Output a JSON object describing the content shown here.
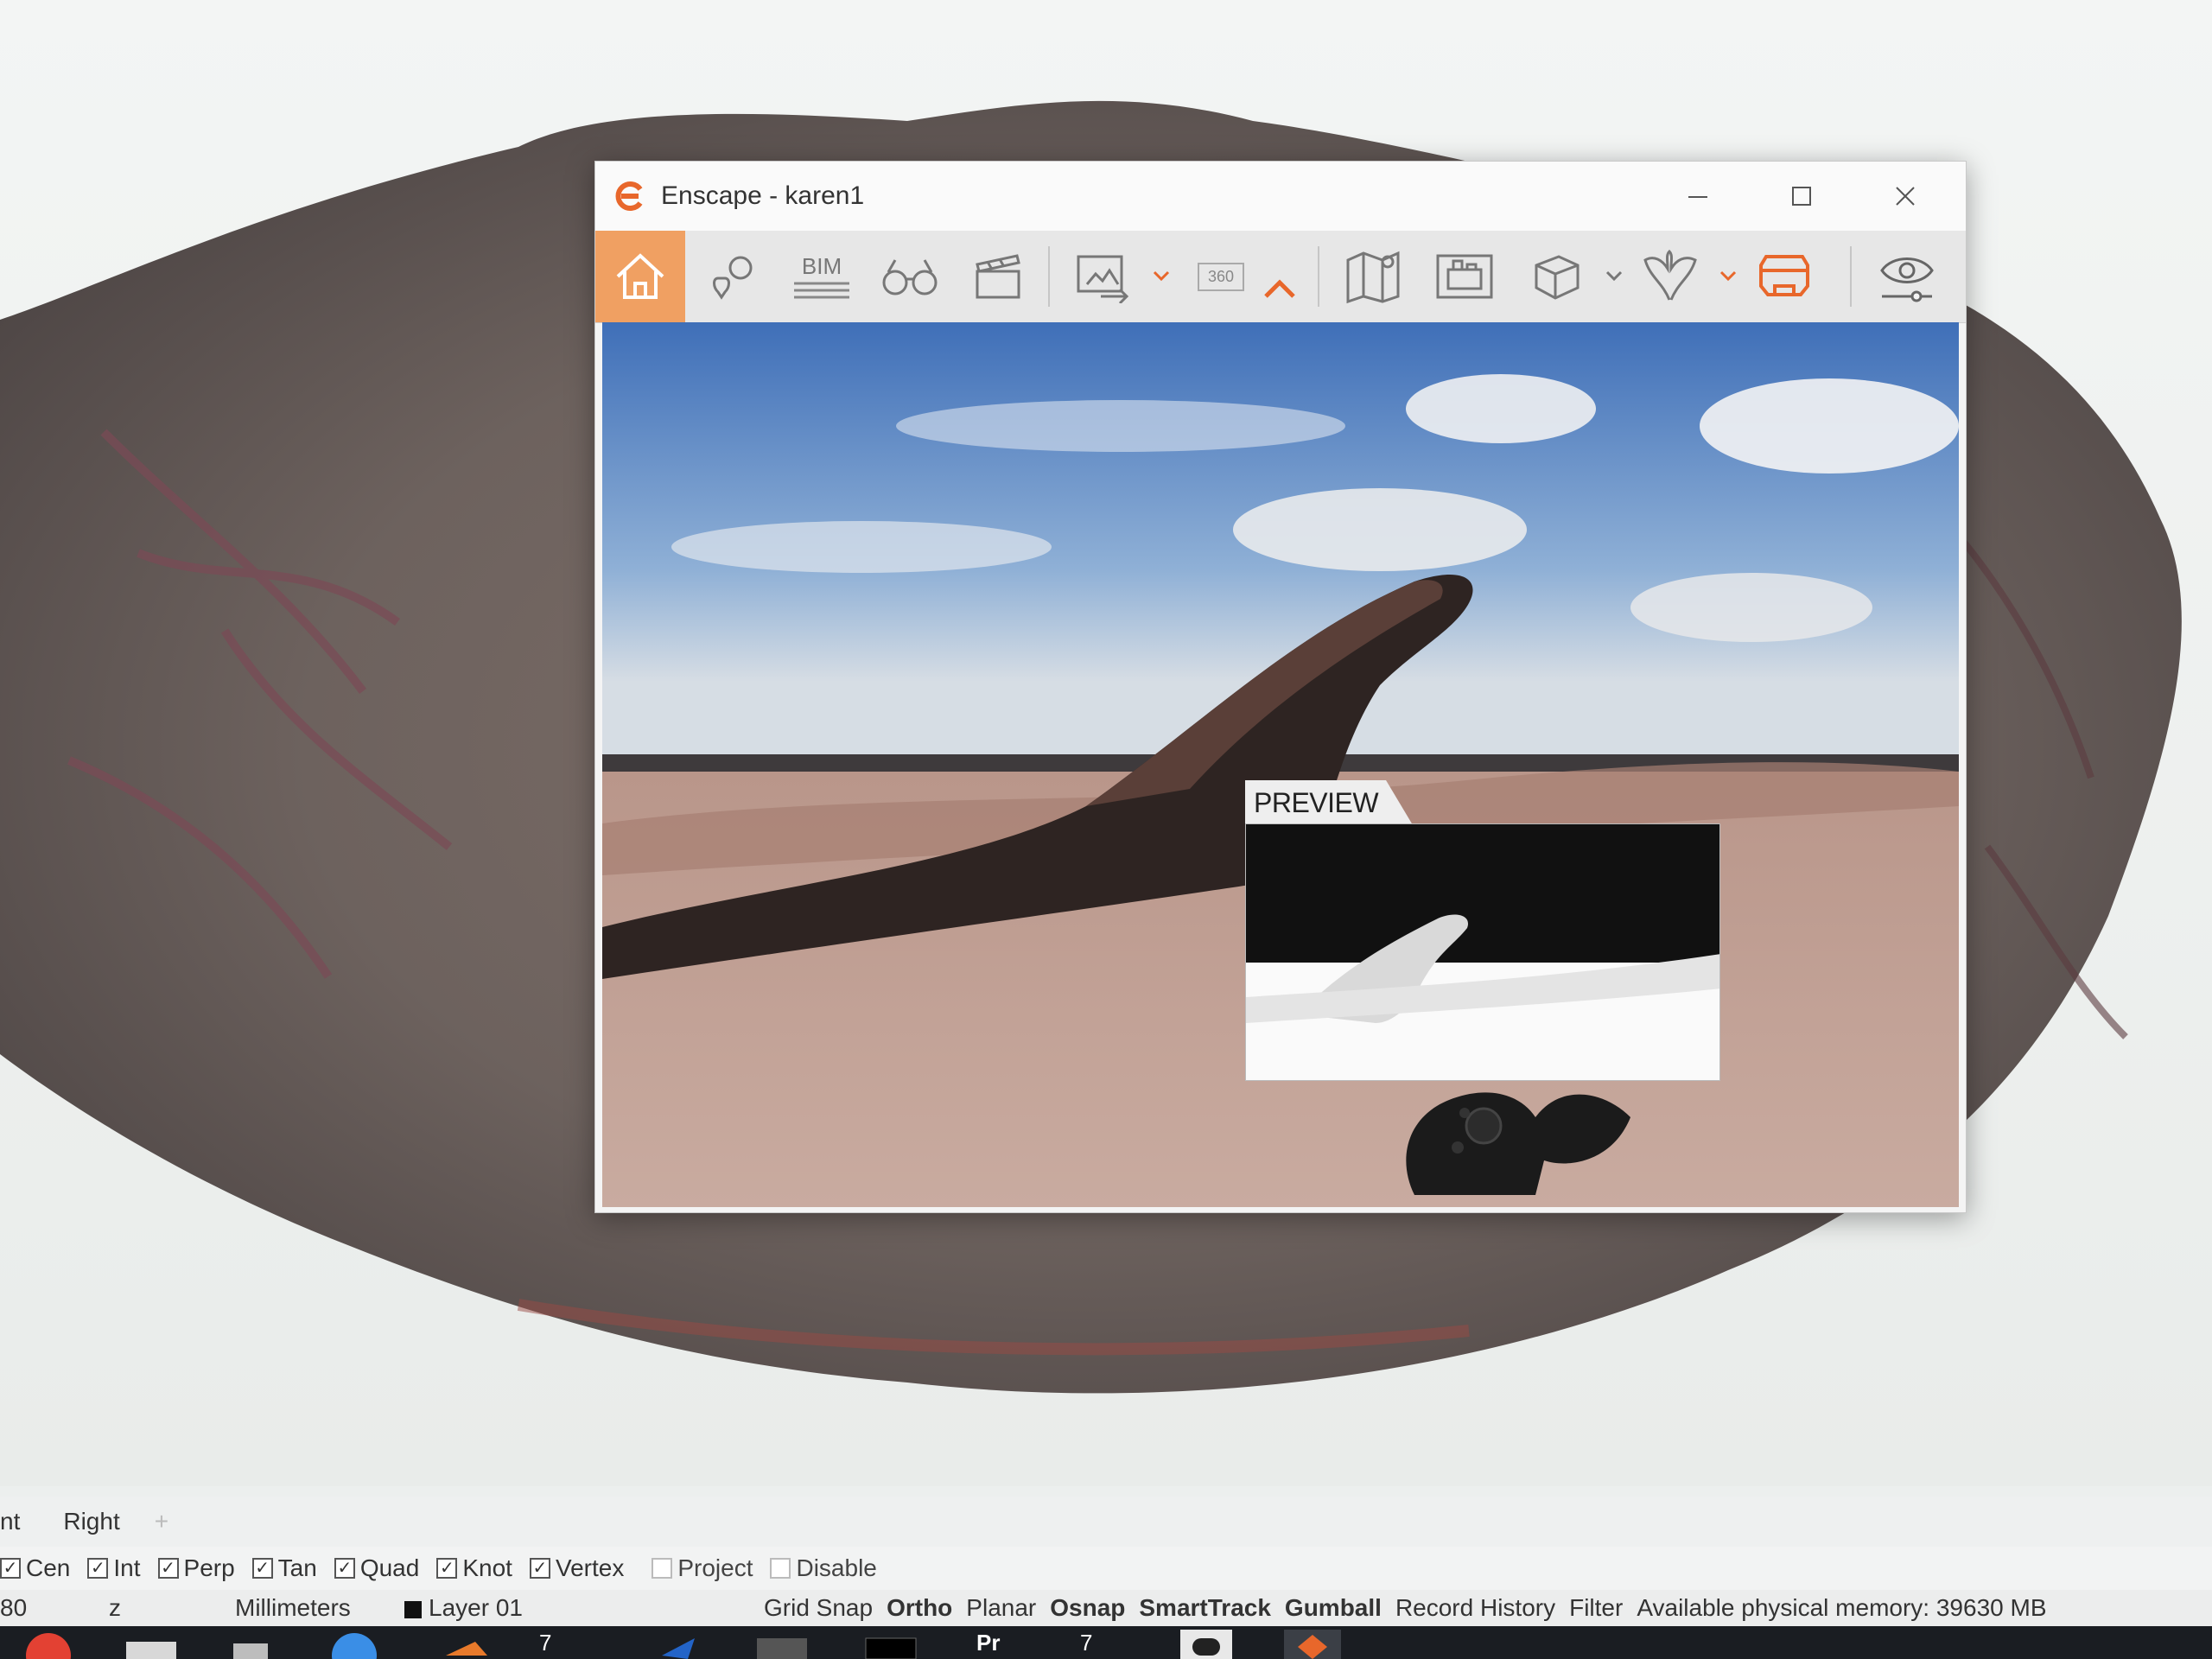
{
  "enscape": {
    "title": "Enscape - karen1",
    "toolbar": {
      "bim_label": "BIM",
      "pano_label": "360"
    },
    "preview_label": "PREVIEW"
  },
  "rhino": {
    "view_tabs": [
      "nt",
      "Right",
      "+"
    ],
    "osnaps": [
      {
        "label": "Cen",
        "checked": true
      },
      {
        "label": "Int",
        "checked": true
      },
      {
        "label": "Perp",
        "checked": true
      },
      {
        "label": "Tan",
        "checked": true
      },
      {
        "label": "Quad",
        "checked": true
      },
      {
        "label": "Knot",
        "checked": true
      },
      {
        "label": "Vertex",
        "checked": true
      },
      {
        "label": "Project",
        "checked": false
      },
      {
        "label": "Disable",
        "checked": false
      }
    ],
    "status": {
      "coord": "80",
      "z": "z",
      "units": "Millimeters",
      "layer": "Layer 01",
      "grid_snap": "Grid Snap",
      "ortho": "Ortho",
      "planar": "Planar",
      "osnap": "Osnap",
      "smarttrack": "SmartTrack",
      "gumball": "Gumball",
      "record_history": "Record History",
      "filter": "Filter",
      "memory": "Available physical memory: 39630 MB"
    }
  },
  "taskbar": {
    "rhino_badge_1": "7",
    "premiere_label": "Pr",
    "rhino_badge_2": "7"
  },
  "colors": {
    "accent": "#f0a062",
    "enscape_orange": "#e8672b"
  }
}
